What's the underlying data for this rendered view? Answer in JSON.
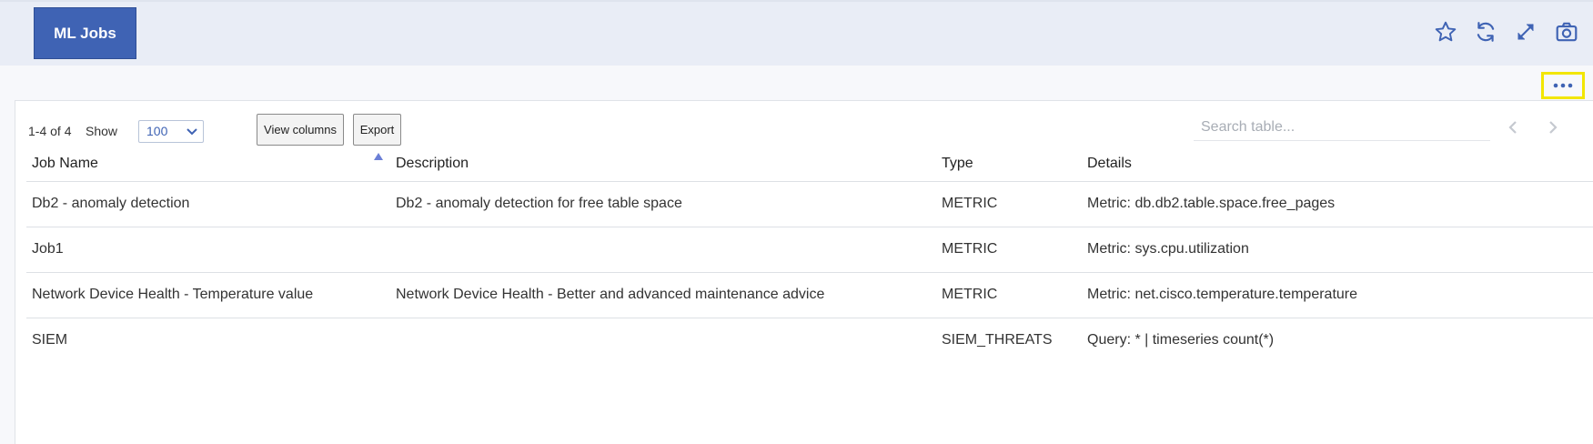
{
  "header": {
    "title": "ML Jobs",
    "icons": [
      "star-icon",
      "refresh-icon",
      "expand-icon",
      "camera-icon"
    ],
    "more_icon": "more-options-icon"
  },
  "colors": {
    "accent": "#3f63b4",
    "header_bg": "#e9edf6",
    "highlight": "#f2e600",
    "sort_indicator": "#6b7fd6"
  },
  "toolbar": {
    "range": "1-4 of 4",
    "show_label": "Show",
    "show_value": "100",
    "view_columns_label": "View columns",
    "export_label": "Export",
    "search_placeholder": "Search table..."
  },
  "table": {
    "columns": [
      "Job Name",
      "Description",
      "Type",
      "Details"
    ],
    "sorted_column": "Job Name",
    "sort_direction": "ascending",
    "rows": [
      {
        "name": "Db2 - anomaly detection",
        "description": "Db2 - anomaly detection for free table space",
        "type": "METRIC",
        "details": "Metric: db.db2.table.space.free_pages"
      },
      {
        "name": "Job1",
        "description": "",
        "type": "METRIC",
        "details": "Metric: sys.cpu.utilization"
      },
      {
        "name": "Network Device Health - Temperature value",
        "description": "Network Device Health - Better and advanced maintenance advice",
        "type": "METRIC",
        "details": "Metric: net.cisco.temperature.temperature"
      },
      {
        "name": "SIEM",
        "description": "",
        "type": "SIEM_THREATS",
        "details": "Query: * | timeseries count(*)"
      }
    ]
  }
}
